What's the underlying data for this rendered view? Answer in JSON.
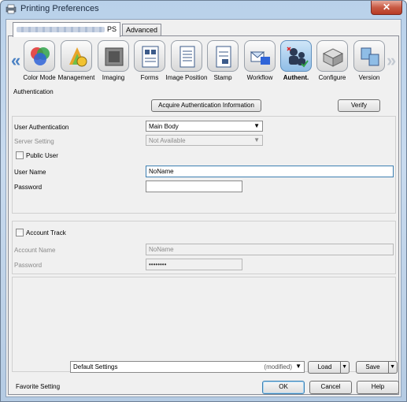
{
  "window": {
    "title": "Printing Preferences",
    "close_symbol": "✕"
  },
  "tabs": {
    "main_suffix": "PS",
    "advanced": "Advanced"
  },
  "toolbar": {
    "items": [
      {
        "label": "Color Mode",
        "icon": "color-mode-icon"
      },
      {
        "label": "Management",
        "icon": "management-icon"
      },
      {
        "label": "Imaging",
        "icon": "imaging-icon"
      },
      {
        "label": "Forms",
        "icon": "forms-icon"
      },
      {
        "label": "Image Position",
        "icon": "image-position-icon"
      },
      {
        "label": "Stamp",
        "icon": "stamp-icon"
      },
      {
        "label": "Workflow",
        "icon": "workflow-icon"
      },
      {
        "label": "Authent.",
        "icon": "authentication-icon",
        "selected": true
      },
      {
        "label": "Configure",
        "icon": "configure-icon"
      },
      {
        "label": "Version",
        "icon": "version-icon"
      }
    ],
    "prev_arrow": "«",
    "next_arrow": "»"
  },
  "authentication": {
    "section_title": "Authentication",
    "acquire_button": "Acquire Authentication Information",
    "verify_button": "Verify",
    "user_auth_label": "User Authentication",
    "user_auth_value": "Main Body",
    "server_setting_label": "Server Setting",
    "server_setting_value": "Not Available",
    "public_user_label": "Public User",
    "user_name_label": "User Name",
    "user_name_value": "NoName",
    "password_label": "Password",
    "password_value": ""
  },
  "account_track": {
    "label": "Account Track",
    "account_name_label": "Account Name",
    "account_name_value": "NoName",
    "password_label": "Password",
    "password_value": "••••••••"
  },
  "favorite": {
    "label": "Favorite Setting",
    "value": "Default Settings",
    "status": "(modified)",
    "load_button": "Load",
    "save_button": "Save"
  },
  "dialog": {
    "ok": "OK",
    "cancel": "Cancel",
    "help": "Help"
  },
  "colors": {
    "accent": "#3c7fb1",
    "selected_tab": "#8fbde6",
    "close": "#c85a44"
  }
}
